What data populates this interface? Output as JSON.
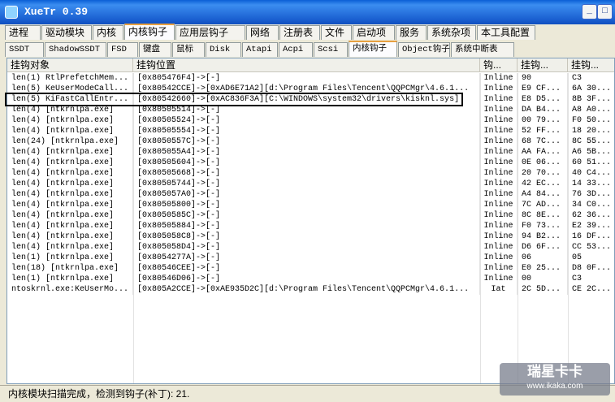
{
  "window": {
    "title": "XueTr 0.39",
    "min_label": "_",
    "max_label": "□"
  },
  "tabs_row1": [
    "进程",
    "驱动模块",
    "内核",
    "内核钩子",
    "应用层钩子",
    "网络",
    "注册表",
    "文件",
    "启动项",
    "服务",
    "系统杂项",
    "本工具配置"
  ],
  "tabs_row1_active": "内核钩子",
  "tabs_row2": [
    "SSDT",
    "ShadowSSDT",
    "FSD",
    "键盘",
    "鼠标",
    "Disk",
    "Atapi",
    "Acpi",
    "Scsi",
    "内核钩子",
    "Object钩子",
    "系统中断表"
  ],
  "tabs_row2_active": "内核钩子",
  "columns": [
    "挂钩对象",
    "挂钩位置",
    "钩...",
    "挂钩...",
    "挂钩..."
  ],
  "rows": [
    [
      "len(1) RtlPrefetchMem...",
      "[0x805476F4]->[-]",
      "Inline",
      "90",
      "C3"
    ],
    [
      "len(5) KeUserModeCall...",
      "[0x80542CCE]->[0xAD6E71A2][d:\\Program Files\\Tencent\\QQPCMgr\\4.6.1...",
      "Inline",
      "E9 CF...",
      "6A 30..."
    ],
    [
      "len(5) KiFastCallEntr...",
      "[0x80542660]->[0xAC836F3A][C:\\WINDOWS\\system32\\drivers\\kisknl.sys]",
      "Inline",
      "E8 D5...",
      "8B 3F..."
    ],
    [
      "len(4) [ntkrnlpa.exe]",
      "[0x80505514]->[-]",
      "Inline",
      "DA B4...",
      "A8 A0..."
    ],
    [
      "len(4) [ntkrnlpa.exe]",
      "[0x80505524]->[-]",
      "Inline",
      "00 79...",
      "F0 50..."
    ],
    [
      "len(4) [ntkrnlpa.exe]",
      "[0x80505554]->[-]",
      "Inline",
      "52 FF...",
      "18 20..."
    ],
    [
      "len(24) [ntkrnlpa.exe]",
      "[0x8050557C]->[-]",
      "Inline",
      "68 7C...",
      "8C 55..."
    ],
    [
      "len(4) [ntkrnlpa.exe]",
      "[0x805055A4]->[-]",
      "Inline",
      "AA FA...",
      "A6 5B..."
    ],
    [
      "len(4) [ntkrnlpa.exe]",
      "[0x80505604]->[-]",
      "Inline",
      "0E 06...",
      "60 51..."
    ],
    [
      "len(4) [ntkrnlpa.exe]",
      "[0x80505668]->[-]",
      "Inline",
      "20 70...",
      "40 C4..."
    ],
    [
      "len(4) [ntkrnlpa.exe]",
      "[0x80505744]->[-]",
      "Inline",
      "42 EC...",
      "14 33..."
    ],
    [
      "len(4) [ntkrnlpa.exe]",
      "[0x805057A0]->[-]",
      "Inline",
      "A4 84...",
      "76 3D..."
    ],
    [
      "len(4) [ntkrnlpa.exe]",
      "[0x80505800]->[-]",
      "Inline",
      "7C AD...",
      "34 C0..."
    ],
    [
      "len(4) [ntkrnlpa.exe]",
      "[0x8050585C]->[-]",
      "Inline",
      "8C 8E...",
      "62 36..."
    ],
    [
      "len(4) [ntkrnlpa.exe]",
      "[0x80505884]->[-]",
      "Inline",
      "F0 73...",
      "E2 39..."
    ],
    [
      "len(4) [ntkrnlpa.exe]",
      "[0x805058C8]->[-]",
      "Inline",
      "94 B2...",
      "16 DF..."
    ],
    [
      "len(4) [ntkrnlpa.exe]",
      "[0x805058D4]->[-]",
      "Inline",
      "D6 6F...",
      "CC 53..."
    ],
    [
      "len(1) [ntkrnlpa.exe]",
      "[0x8054277A]->[-]",
      "Inline",
      "06",
      "05"
    ],
    [
      "len(18) [ntkrnlpa.exe]",
      "[0x80546CEE]->[-]",
      "Inline",
      "E0 25...",
      "D8 0F..."
    ],
    [
      "len(1) [ntkrnlpa.exe]",
      "[0x80546D06]->[-]",
      "Inline",
      "00",
      "C3"
    ],
    [
      "ntoskrnl.exe:KeUserMo...",
      "[0x805A2CCE]->[0xAE935D2C][d:\\Program Files\\Tencent\\QQPCMgr\\4.6.1...",
      "Iat",
      "2C 5D...",
      "CE 2C..."
    ]
  ],
  "highlight_row_index": 2,
  "status": "内核模块扫描完成，检测到钩子(补丁): 21.",
  "watermark": {
    "line1": "瑞星卡卡",
    "line2": "www.ikaka.com"
  }
}
